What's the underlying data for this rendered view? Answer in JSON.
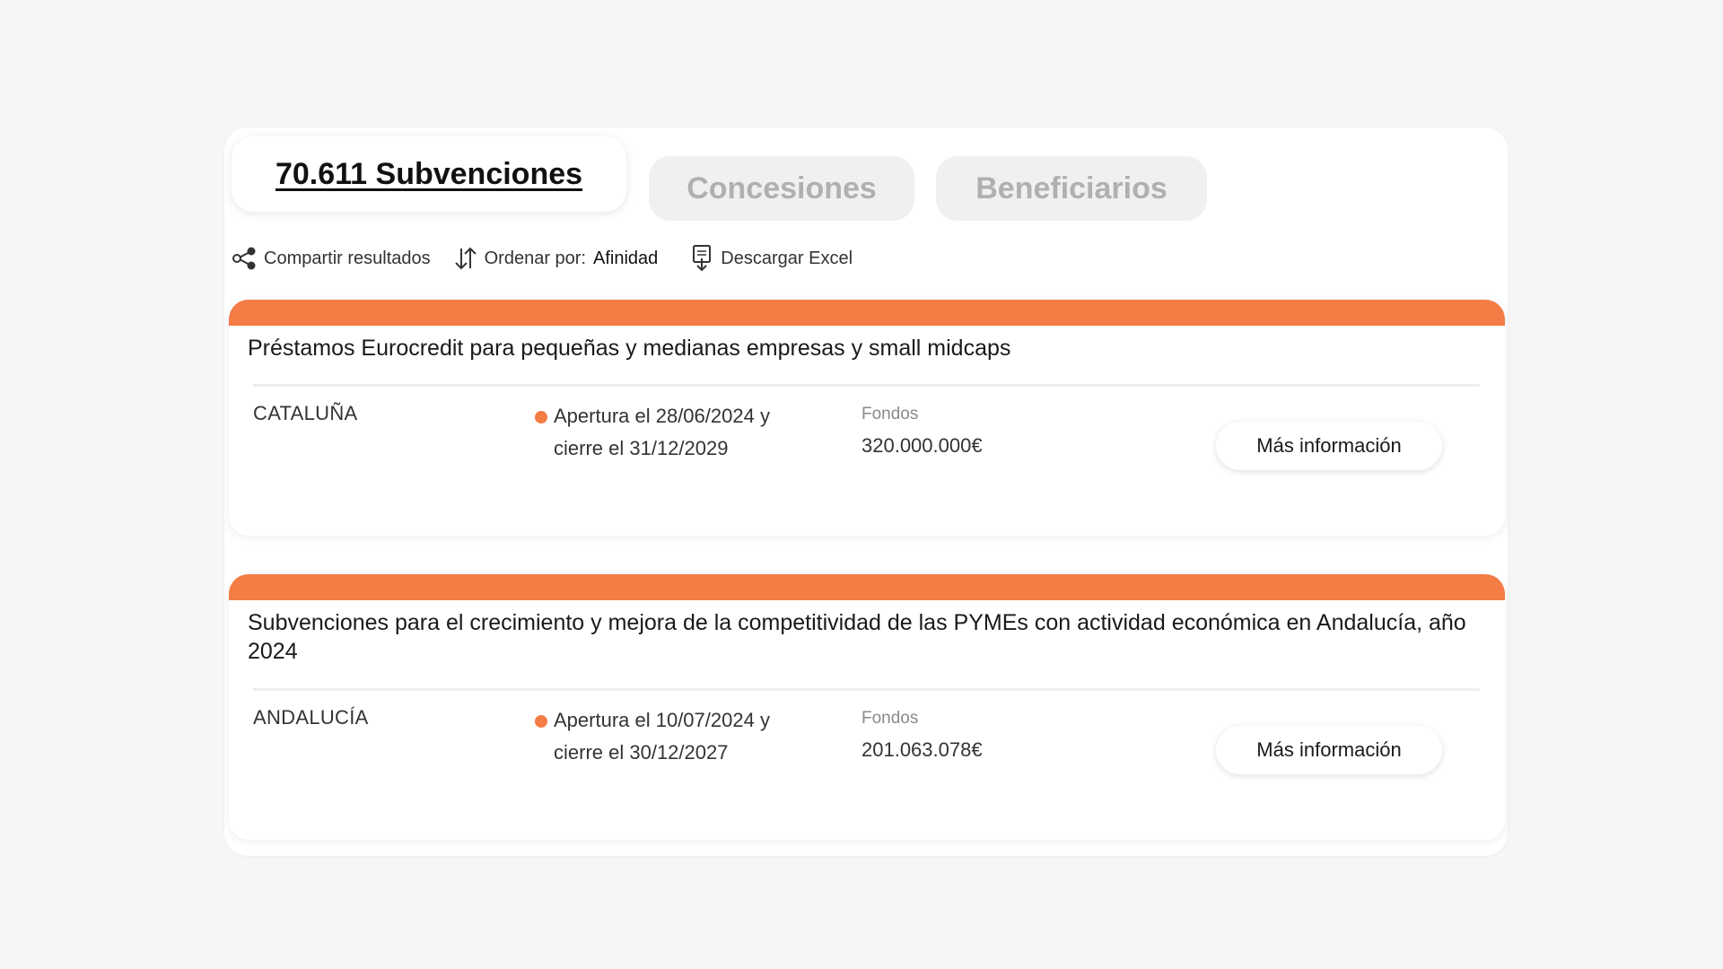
{
  "tabs": {
    "subvenciones": "70.611 Subvenciones",
    "concesiones": "Concesiones",
    "beneficiarios": "Beneficiarios"
  },
  "toolbar": {
    "share_label": "Compartir resultados",
    "share_icon": "share-icon",
    "sort_label": "Ordenar por:",
    "sort_value": "Afinidad",
    "sort_icon": "sort-arrows-icon",
    "download_label": "Descargar Excel",
    "download_icon": "excel-download-icon"
  },
  "colors": {
    "accent": "#f47c45",
    "background": "#f6f6f6",
    "inactive_tab_bg": "#f0f0f0",
    "inactive_tab_text": "#b0b0b0"
  },
  "results": [
    {
      "title": "Préstamos Eurocredit para pequeñas y medianas empresas y small midcaps",
      "region": "CATALUÑA",
      "dates_line1": "Apertura el 28/06/2024 y",
      "dates_line2": "cierre el 31/12/2029",
      "funds_label": "Fondos",
      "funds_value": "320.000.000€",
      "button_label": "Más información"
    },
    {
      "title": "Subvenciones para el crecimiento y mejora de la competitividad de las PYMEs con actividad económica en Andalucía, año 2024",
      "region": "ANDALUCÍA",
      "dates_line1": "Apertura el 10/07/2024 y",
      "dates_line2": "cierre el 30/12/2027",
      "funds_label": "Fondos",
      "funds_value": "201.063.078€",
      "button_label": "Más información"
    }
  ]
}
